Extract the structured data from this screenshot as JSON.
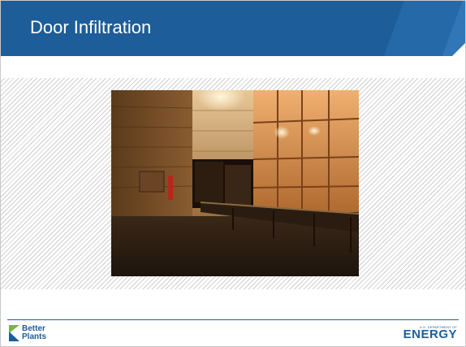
{
  "slide": {
    "title": "Door Infiltration"
  },
  "photo": {
    "subject": "loading-dock-door-infiltration-photo"
  },
  "footer": {
    "left_logo_line1": "Better",
    "left_logo_line2": "Plants",
    "right_logo_small": "U.S. DEPARTMENT OF",
    "right_logo_big": "ENERGY"
  },
  "colors": {
    "header_blue": "#1d5d99",
    "accent_green": "#7cb342"
  }
}
